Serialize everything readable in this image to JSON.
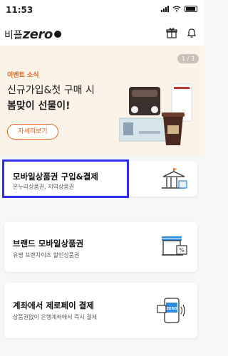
{
  "status_bar": {
    "time": "11:53"
  },
  "header": {
    "brand_prefix": "비플",
    "brand_name": "zero",
    "gift_icon": "gift-icon",
    "bell_icon": "bell-icon"
  },
  "banner": {
    "event_label": "이벤트 소식",
    "line1": "신규가입&첫 구매 시",
    "line2": "봄맞이 선물이!",
    "detail_button": "자세히보기",
    "pager": "1 / 3",
    "accent_color": "#e2681f",
    "background_color": "#fbf3e8"
  },
  "menu": {
    "items": [
      {
        "title": "모바일상품권 구입&결제",
        "subtitle": "온누리상품권, 지역상품권",
        "icon": "building-icon"
      },
      {
        "title": "브랜드 모바일상품권",
        "subtitle": "유명 프랜차이즈 할인상품권",
        "icon": "store-icon"
      },
      {
        "title": "계좌에서 제로페이 결제",
        "subtitle": "상품권없이 은행계좌에서 즉시 결제",
        "icon": "phone-pay-icon"
      }
    ]
  },
  "phone_screen_label": "ZERO",
  "highlight_color": "#2f2ef0"
}
